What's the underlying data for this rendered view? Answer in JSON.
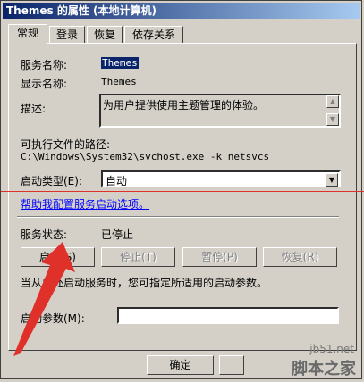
{
  "window": {
    "title": "Themes 的属性 (本地计算机)"
  },
  "tabs": [
    {
      "label": "常规"
    },
    {
      "label": "登录"
    },
    {
      "label": "恢复"
    },
    {
      "label": "依存关系"
    }
  ],
  "general": {
    "service_name_label": "服务名称:",
    "service_name_value": "Themes",
    "display_name_label": "显示名称:",
    "display_name_value": "Themes",
    "description_label": "描述:",
    "description_value": "为用户提供使用主题管理的体验。",
    "exe_path_label": "可执行文件的路径:",
    "exe_path_value": "C:\\Windows\\System32\\svchost.exe -k netsvcs",
    "startup_type_label": "启动类型(E):",
    "startup_type_value": "自动",
    "help_link": "帮助我配置服务启动选项。",
    "status_label": "服务状态:",
    "status_value": "已停止",
    "start_button": "启动(S)",
    "stop_button": "停止(T)",
    "pause_button": "暂停(P)",
    "resume_button": "恢复(R)",
    "hint_text": "当从此处启动服务时，您可指定所适用的启动参数。",
    "start_params_label": "启动参数(M):",
    "start_params_value": ""
  },
  "dialog_buttons": {
    "ok": "确定"
  },
  "watermark": {
    "site": "jb51.net",
    "brand": "脚本之家"
  },
  "annotation": {
    "arrow_color": "#e0302a",
    "line_color": "#e0302a"
  }
}
